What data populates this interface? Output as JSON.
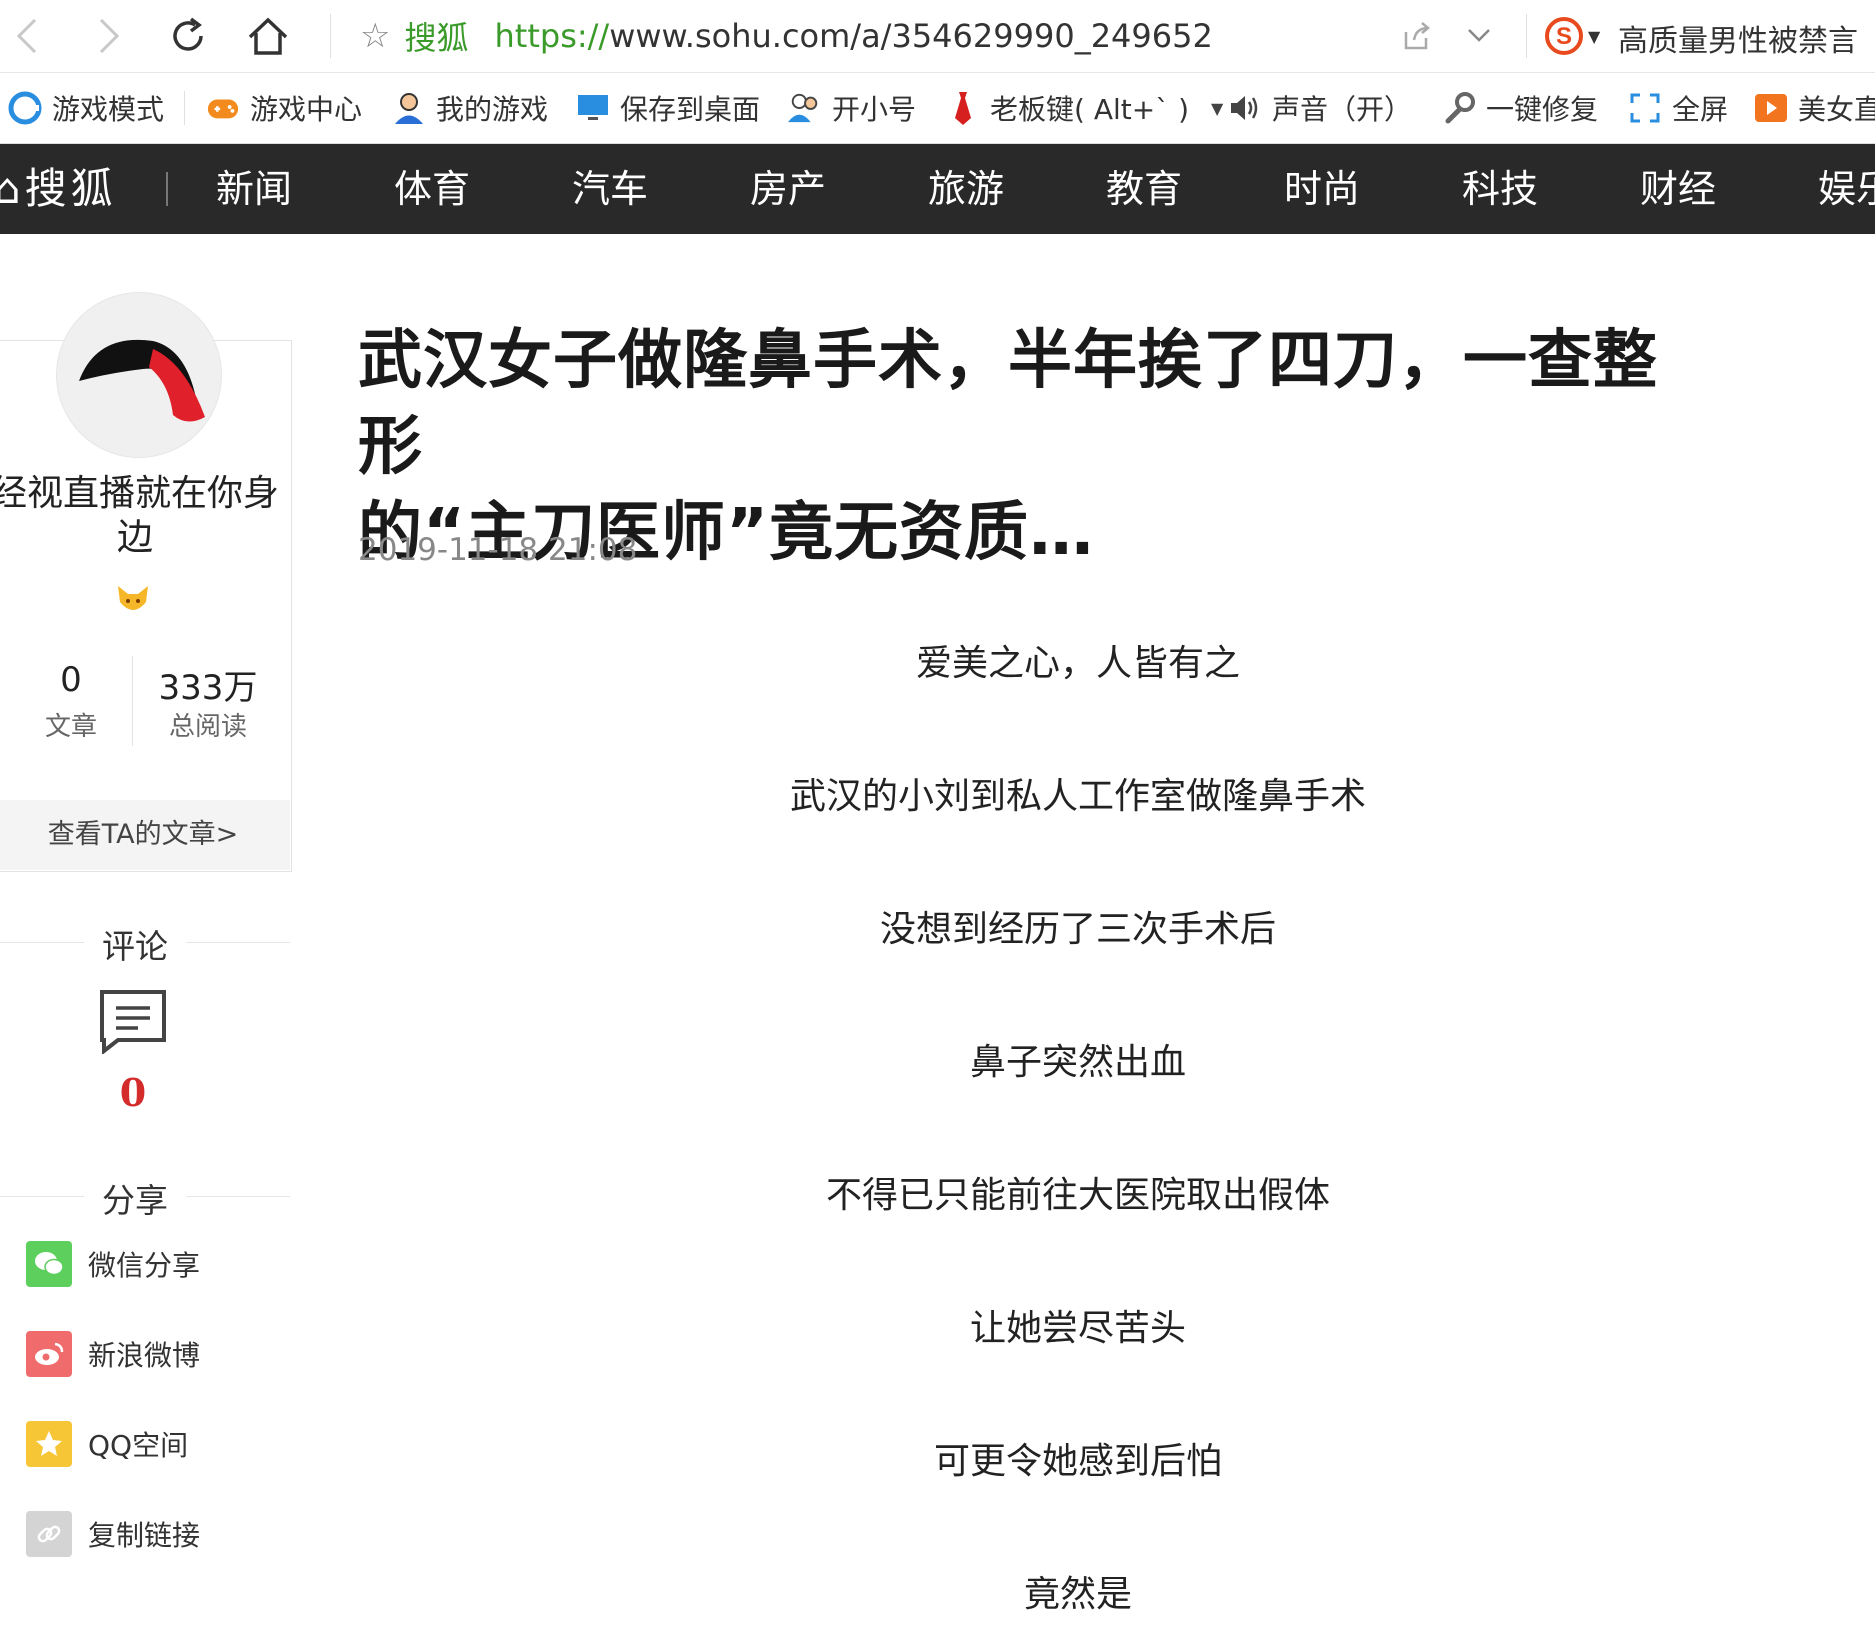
{
  "browser": {
    "site_name": "搜狐",
    "url_scheme": "https://",
    "url_rest": "www.sohu.com/a/354629990_249652",
    "search_text": "高质量男性被禁言"
  },
  "bookmarks": [
    {
      "label": "游戏模式",
      "icon": "game-mode-icon"
    },
    {
      "label": "游戏中心",
      "icon": "gamepad-icon"
    },
    {
      "label": "我的游戏",
      "icon": "user-icon"
    },
    {
      "label": "保存到桌面",
      "icon": "monitor-icon"
    },
    {
      "label": "开小号",
      "icon": "users-icon"
    },
    {
      "label": "老板键( Alt+` )",
      "icon": "tie-icon"
    },
    {
      "label": "声音（开）",
      "icon": "speaker-icon"
    },
    {
      "label": "一键修复",
      "icon": "wrench-icon"
    },
    {
      "label": "全屏",
      "icon": "fullscreen-icon"
    },
    {
      "label": "美女直",
      "icon": "play-icon"
    }
  ],
  "site_nav": {
    "logo": "搜狐",
    "items": [
      "新闻",
      "体育",
      "汽车",
      "房产",
      "旅游",
      "教育",
      "时尚",
      "科技",
      "财经",
      "娱乐"
    ]
  },
  "author": {
    "name": "经视直播就在你身边",
    "articles_count": "0",
    "articles_label": "文章",
    "reads_count": "333万",
    "reads_label": "总阅读",
    "view_link": "查看TA的文章>"
  },
  "comment": {
    "title": "评论",
    "count": "0"
  },
  "share": {
    "title": "分享",
    "items": [
      {
        "label": "微信分享",
        "color": "#5ccf5c"
      },
      {
        "label": "新浪微博",
        "color": "#f06b6b"
      },
      {
        "label": "QQ空间",
        "color": "#f7c636"
      },
      {
        "label": "复制链接",
        "color": "#d4d4d4"
      }
    ]
  },
  "article": {
    "title_line1": "武汉女子做隆鼻手术，半年挨了四刀，一查整形",
    "title_line2": "的“主刀医师”竟无资质…",
    "date": "2019-11-18 21:08",
    "paragraphs": [
      "爱美之心，人皆有之",
      "武汉的小刘到私人工作室做隆鼻手术",
      "没想到经历了三次手术后",
      "鼻子突然出血",
      "不得已只能前往大医院取出假体",
      "让她尝尽苦头",
      "可更令她感到后怕",
      "竟然是"
    ]
  }
}
